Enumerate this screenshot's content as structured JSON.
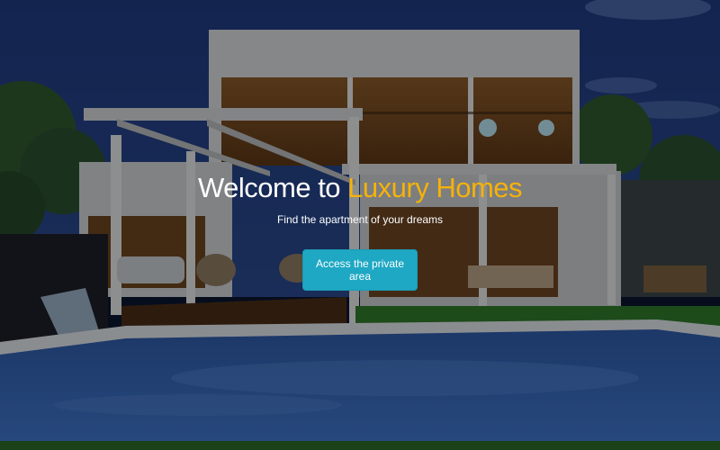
{
  "hero": {
    "title_prefix": "Welcome to ",
    "title_accent": "Luxury Homes",
    "subtitle": "Find the apartment of your dreams",
    "cta_label": "Access the private area"
  },
  "colors": {
    "accent": "#f5b20a",
    "button": "#1ea8c4",
    "text": "#ffffff"
  }
}
